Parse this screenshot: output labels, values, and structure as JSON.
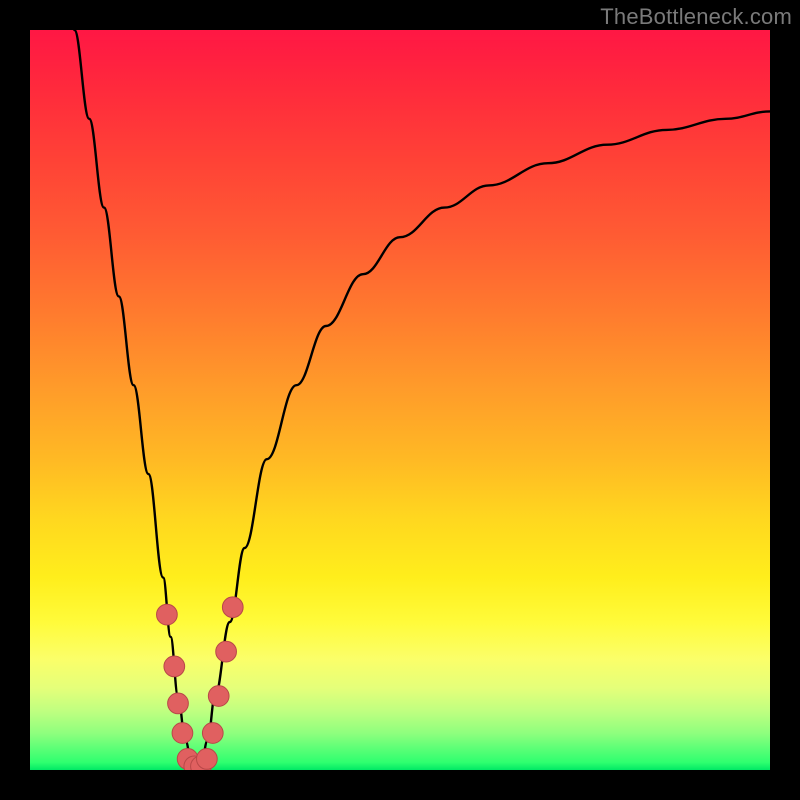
{
  "watermark": "TheBottleneck.com",
  "colors": {
    "frame": "#000000",
    "curve": "#000000",
    "marker_fill": "#e06060",
    "marker_stroke": "#b84848",
    "gradient_top": "#ff1744",
    "gradient_bottom": "#00e865"
  },
  "chart_data": {
    "type": "line",
    "title": "",
    "xlabel": "",
    "ylabel": "",
    "xlim": [
      0,
      100
    ],
    "ylim": [
      0,
      100
    ],
    "grid": false,
    "legend": false,
    "series": [
      {
        "name": "bottleneck-curve",
        "x": [
          6,
          8,
          10,
          12,
          14,
          16,
          18,
          19,
          20,
          21,
          22,
          23,
          24,
          25,
          27,
          29,
          32,
          36,
          40,
          45,
          50,
          56,
          62,
          70,
          78,
          86,
          94,
          100
        ],
        "y": [
          100,
          88,
          76,
          64,
          52,
          40,
          26,
          18,
          10,
          4,
          0,
          0,
          4,
          10,
          20,
          30,
          42,
          52,
          60,
          67,
          72,
          76,
          79,
          82,
          84.5,
          86.5,
          88,
          89
        ]
      }
    ],
    "markers": [
      {
        "x": 18.5,
        "y": 21
      },
      {
        "x": 19.5,
        "y": 14
      },
      {
        "x": 20.0,
        "y": 9
      },
      {
        "x": 20.6,
        "y": 5
      },
      {
        "x": 21.3,
        "y": 1.5
      },
      {
        "x": 22.2,
        "y": 0.5
      },
      {
        "x": 23.1,
        "y": 0.5
      },
      {
        "x": 23.9,
        "y": 1.5
      },
      {
        "x": 24.7,
        "y": 5
      },
      {
        "x": 25.5,
        "y": 10
      },
      {
        "x": 26.5,
        "y": 16
      },
      {
        "x": 27.4,
        "y": 22
      }
    ],
    "marker_radius_pct": 1.4
  }
}
